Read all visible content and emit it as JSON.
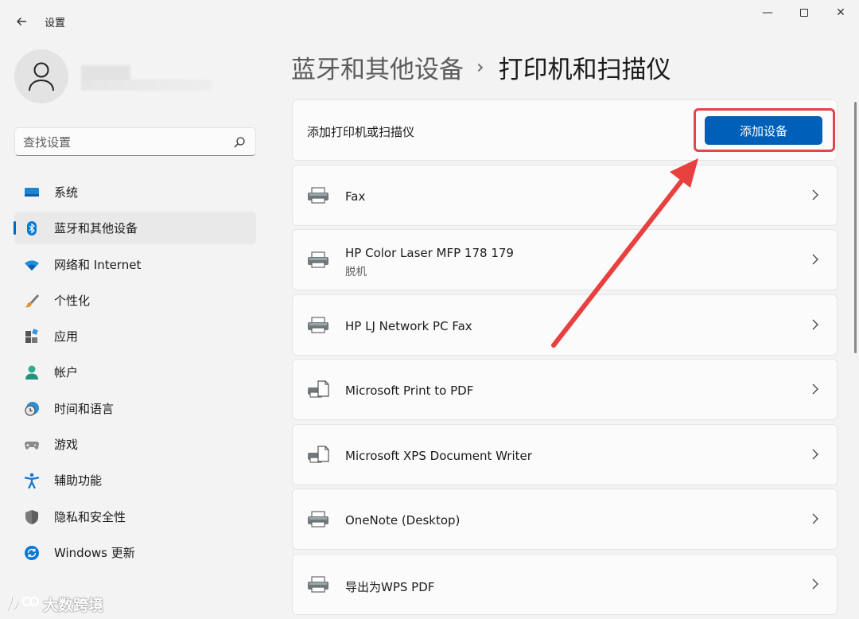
{
  "window": {
    "title": "设置",
    "min": "—",
    "close": "✕"
  },
  "sidebar": {
    "search_placeholder": "查找设置",
    "items": [
      {
        "label": "系统",
        "icon": "monitor-icon",
        "active": false
      },
      {
        "label": "蓝牙和其他设备",
        "icon": "bluetooth-icon",
        "active": true
      },
      {
        "label": "网络和 Internet",
        "icon": "wifi-icon",
        "active": false
      },
      {
        "label": "个性化",
        "icon": "brush-icon",
        "active": false
      },
      {
        "label": "应用",
        "icon": "apps-icon",
        "active": false
      },
      {
        "label": "帐户",
        "icon": "account-icon",
        "active": false
      },
      {
        "label": "时间和语言",
        "icon": "clock-globe-icon",
        "active": false
      },
      {
        "label": "游戏",
        "icon": "gamepad-icon",
        "active": false
      },
      {
        "label": "辅助功能",
        "icon": "accessibility-icon",
        "active": false
      },
      {
        "label": "隐私和安全性",
        "icon": "shield-icon",
        "active": false
      },
      {
        "label": "Windows 更新",
        "icon": "update-icon",
        "active": false
      }
    ]
  },
  "breadcrumb": {
    "parent": "蓝牙和其他设备",
    "separator": "›",
    "current": "打印机和扫描仪"
  },
  "add_section": {
    "label": "添加打印机或扫描仪",
    "button": "添加设备"
  },
  "devices": [
    {
      "name": "Fax",
      "status": "",
      "icon": "printer-icon"
    },
    {
      "name": "HP Color Laser MFP 178 179",
      "status": "脱机",
      "icon": "printer-icon"
    },
    {
      "name": "HP LJ Network PC Fax",
      "status": "",
      "icon": "printer-icon"
    },
    {
      "name": "Microsoft Print to PDF",
      "status": "",
      "icon": "printer-document-icon"
    },
    {
      "name": "Microsoft XPS Document Writer",
      "status": "",
      "icon": "printer-document-icon"
    },
    {
      "name": "OneNote (Desktop)",
      "status": "",
      "icon": "printer-icon"
    },
    {
      "name": "导出为WPS PDF",
      "status": "",
      "icon": "printer-icon"
    }
  ],
  "watermark": {
    "text": "大数跨境"
  },
  "colors": {
    "accent": "#005fb8",
    "highlight": "#e0474a",
    "arrow": "#e8403f"
  }
}
